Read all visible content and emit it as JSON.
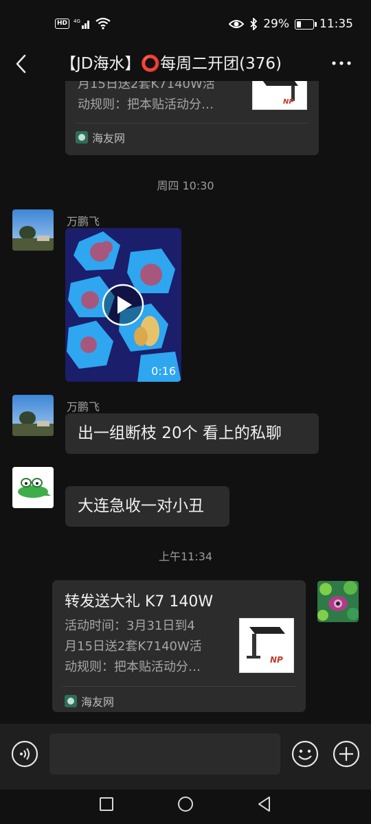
{
  "status": {
    "left_badges": "HD 4G",
    "battery_percent": "29%",
    "battery_level": 0.29,
    "time": "11:35"
  },
  "header": {
    "title": "【JD海水】⭕每周二开团(376)"
  },
  "messages": {
    "top_card": {
      "desc_line1": "月15日送2套K7140W活",
      "desc_line2": "动规则：把本贴活动分…",
      "source": "海友网",
      "thumb_brand": "NP"
    },
    "timestamp1": "周四 10:30",
    "video_msg": {
      "sender": "万鹏飞",
      "duration": "0:16"
    },
    "text_msg1": {
      "sender": "万鹏飞",
      "text": "出一组断枝 20个 看上的私聊"
    },
    "text_msg2": {
      "text": "大连急收一对小丑"
    },
    "timestamp2": "上午11:34",
    "own_card": {
      "title": "转发送大礼 K7 140W",
      "desc_line1": "活动时间：3月31日到4",
      "desc_line2": "月15日送2套K7140W活",
      "desc_line3": "动规则：把本贴活动分…",
      "source": "海友网",
      "thumb_brand": "NP"
    }
  },
  "colors": {
    "background": "#111111",
    "bubble": "#2c2c2c",
    "input_bar": "#1f1f1f"
  }
}
